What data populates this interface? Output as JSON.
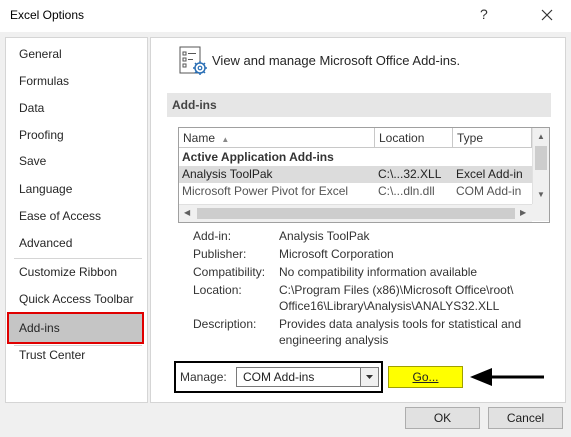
{
  "window": {
    "title": "Excel Options",
    "help_icon": "?",
    "close_icon": "close-icon"
  },
  "sidebar": {
    "items": [
      {
        "label": "General"
      },
      {
        "label": "Formulas"
      },
      {
        "label": "Data"
      },
      {
        "label": "Proofing"
      },
      {
        "label": "Save"
      },
      {
        "label": "Language"
      },
      {
        "label": "Ease of Access"
      },
      {
        "label": "Advanced"
      },
      {
        "label": "Customize Ribbon"
      },
      {
        "label": "Quick Access Toolbar"
      },
      {
        "label": "Add-ins",
        "selected": true
      },
      {
        "label": "Trust Center"
      }
    ]
  },
  "main": {
    "header_text": "View and manage Microsoft Office Add-ins.",
    "section_title": "Add-ins",
    "grid": {
      "columns": [
        "Name",
        "Location",
        "Type"
      ],
      "sort_indicator": "▲",
      "group_title": "Active Application Add-ins",
      "rows": [
        {
          "name": "Analysis ToolPak",
          "location": "C:\\...32.XLL",
          "type": "Excel Add-in",
          "selected": true
        },
        {
          "name": "Microsoft Power Pivot for Excel",
          "location": "C:\\...dln.dll",
          "type": "COM Add-in"
        }
      ]
    },
    "details": {
      "addin_label": "Add-in:",
      "addin_value": "Analysis ToolPak",
      "publisher_label": "Publisher:",
      "publisher_value": "Microsoft Corporation",
      "compat_label": "Compatibility:",
      "compat_value": "No compatibility information available",
      "location_label": "Location:",
      "location_line1": "C:\\Program Files (x86)\\Microsoft Office\\root\\",
      "location_line2": "Office16\\Library\\Analysis\\ANALYS32.XLL",
      "description_label": "Description:",
      "description_line1": "Provides data analysis tools for statistical and",
      "description_line2": "engineering analysis"
    },
    "manage": {
      "label": "Manage:",
      "selected": "COM Add-ins"
    },
    "go_button": "Go..."
  },
  "footer": {
    "ok": "OK",
    "cancel": "Cancel"
  },
  "colors": {
    "highlight_box": "#e00000",
    "go_highlight": "#ffff00",
    "selected_bg": "#c5c5c5"
  }
}
